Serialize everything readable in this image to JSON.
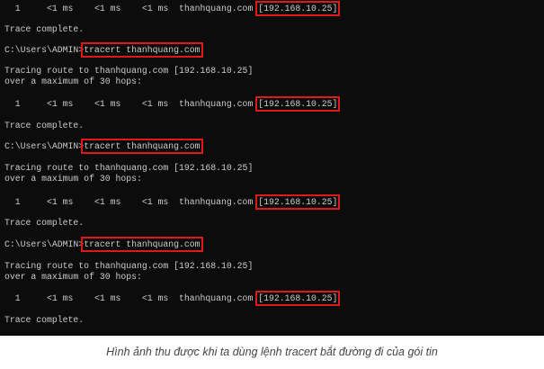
{
  "terminal": {
    "blocks": [
      {
        "hop_prefix": "  1     <1 ms    <1 ms    <1 ms  thanhquang.com ",
        "ip": "[192.168.10.25]",
        "trace_complete": "Trace complete."
      },
      {
        "prompt": "C:\\Users\\ADMIN>",
        "command": "tracert thanhquang.com",
        "tracing": "Tracing route to thanhquang.com [192.168.10.25]",
        "max_hops": "over a maximum of 30 hops:",
        "hop_prefix": "  1     <1 ms    <1 ms    <1 ms  thanhquang.com ",
        "ip": "[192.168.10.25]",
        "trace_complete": "Trace complete."
      },
      {
        "prompt": "C:\\Users\\ADMIN>",
        "command": "tracert thanhquang.com",
        "tracing": "Tracing route to thanhquang.com [192.168.10.25]",
        "max_hops": "over a maximum of 30 hops:",
        "hop_prefix": "  1     <1 ms    <1 ms    <1 ms  thanhquang.com ",
        "ip": "[192.168.10.25]",
        "trace_complete": "Trace complete."
      },
      {
        "prompt": "C:\\Users\\ADMIN>",
        "command": "tracert thanhquang.com",
        "tracing": "Tracing route to thanhquang.com [192.168.10.25]",
        "max_hops": "over a maximum of 30 hops:",
        "hop_prefix": "  1     <1 ms    <1 ms    <1 ms  thanhquang.com ",
        "ip": "[192.168.10.25]",
        "trace_complete": "Trace complete."
      }
    ]
  },
  "caption": "Hình ảnh thu được khi ta dùng lệnh tracert bắt đường đi của gói tin",
  "colors": {
    "background": "#0c0c0c",
    "text": "#cccccc",
    "highlight": "#e01818"
  }
}
